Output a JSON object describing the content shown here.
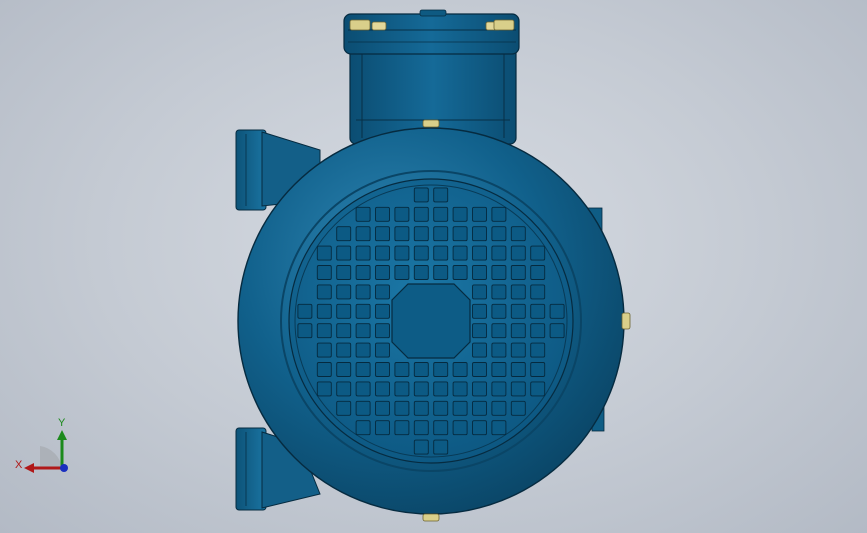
{
  "viewport": {
    "background": "#c4cad3",
    "model_color": "#0f5d85",
    "model_dark": "#0a3f5c",
    "accent_yellow": "#d9cf8a"
  },
  "model": {
    "name": "motor-end-view",
    "grille_rows": 14,
    "grille_cols": 14
  },
  "triad": {
    "x_label": "X",
    "y_label": "Y",
    "x_color": "#b01818",
    "y_color": "#1c8a1c",
    "z_color": "#1a2fbf"
  }
}
